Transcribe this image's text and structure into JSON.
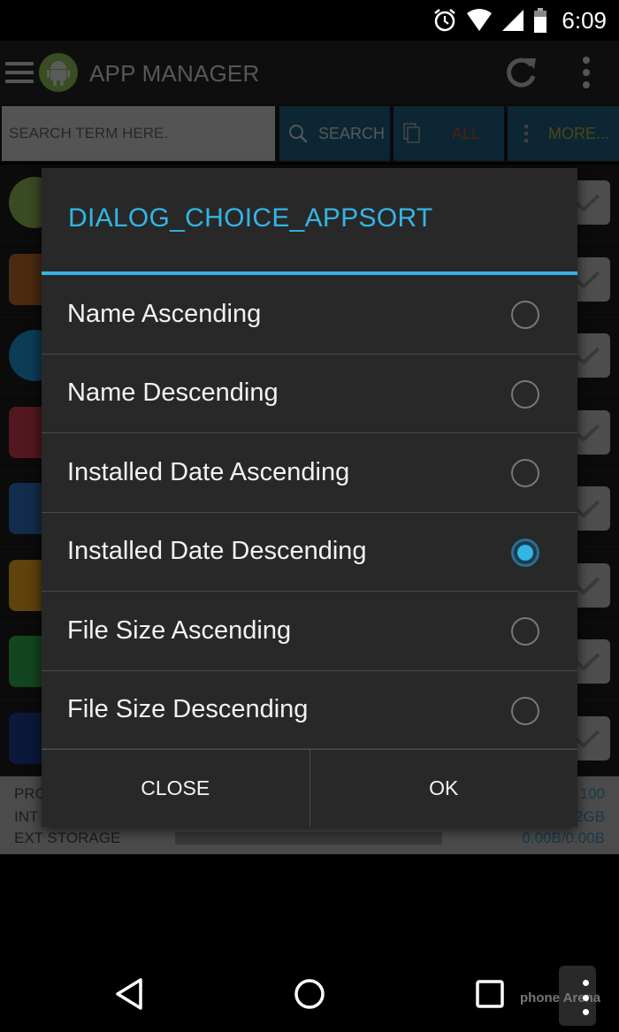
{
  "status_bar": {
    "time": "6:09",
    "icons": [
      "alarm-icon",
      "wifi-icon",
      "cell-signal-icon",
      "battery-icon"
    ]
  },
  "app_bar": {
    "title": "APP MANAGER",
    "icons": {
      "menu": "hamburger-icon",
      "logo": "android-icon",
      "refresh": "refresh-icon",
      "overflow": "more-vert-icon"
    }
  },
  "search": {
    "placeholder": "SEARCH TERM HERE.",
    "value": "",
    "buttons": {
      "search": "SEARCH",
      "all": "ALL",
      "more": "MORE..."
    }
  },
  "app_list": {
    "rows": [
      {
        "icon": "android-app-icon",
        "color": "#8bb554",
        "checked": true
      },
      {
        "icon": "puzzle-app-icon",
        "color": "#b0662a",
        "checked": true
      },
      {
        "icon": "blue-circle-app-icon",
        "color": "#1f8fd0",
        "checked": true
      },
      {
        "icon": "airbnb-app-icon",
        "color": "#c6394b",
        "checked": true
      },
      {
        "icon": "blue-square-app-icon",
        "color": "#2c6db4",
        "checked": true
      },
      {
        "icon": "lightbulb-app-icon",
        "color": "#e0a020",
        "checked": true
      },
      {
        "icon": "wifi-app-icon",
        "color": "#2fa84a",
        "checked": true
      },
      {
        "icon": "here-maps-app-icon",
        "color": "#1b3b8a",
        "checked": true
      }
    ]
  },
  "storage": {
    "rows": [
      {
        "label": "PRO",
        "value": "100"
      },
      {
        "label": "INT",
        "value": "2GB"
      },
      {
        "label": "EXT STORAGE",
        "value": "0.00B/0.00B"
      }
    ]
  },
  "dialog": {
    "title": "DIALOG_CHOICE_APPSORT",
    "options": [
      {
        "label": "Name Ascending",
        "selected": false
      },
      {
        "label": "Name Descending",
        "selected": false
      },
      {
        "label": "Installed Date Ascending",
        "selected": false
      },
      {
        "label": "Installed Date Descending",
        "selected": true
      },
      {
        "label": "File Size Ascending",
        "selected": false
      },
      {
        "label": "File Size Descending",
        "selected": false
      }
    ],
    "buttons": {
      "close": "CLOSE",
      "ok": "OK"
    }
  },
  "nav_bar": {
    "back": "back-icon",
    "home": "home-icon",
    "recents": "recents-icon",
    "watermark": "phone Arena"
  },
  "colors": {
    "accent": "#33b5e5",
    "dialog_bg": "#282828",
    "toolbar_button_bg": "#1e5b7a"
  }
}
